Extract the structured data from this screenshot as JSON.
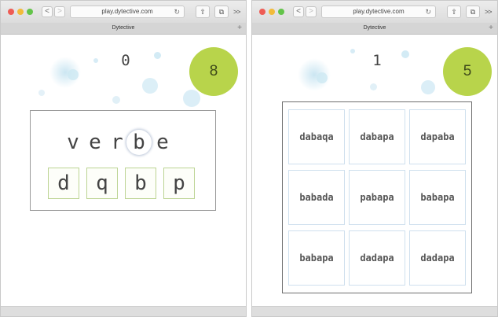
{
  "windows": [
    {
      "url": "play.dytective.com",
      "tab_title": "Dytective",
      "nav": {
        "back": "<",
        "forward": ">"
      },
      "icons": {
        "reload": "↻",
        "share": "⇧",
        "tabs": "⧉",
        "more": ">>",
        "new_tab": "+"
      },
      "score": "0",
      "timer": "8",
      "word_letters": [
        "v",
        "e",
        "r",
        "b",
        "e"
      ],
      "highlighted_letter_index": 3,
      "choices": [
        "d",
        "q",
        "b",
        "p"
      ]
    },
    {
      "url": "play.dytective.com",
      "tab_title": "Dytective",
      "nav": {
        "back": "<",
        "forward": ">"
      },
      "icons": {
        "reload": "↻",
        "share": "⇧",
        "tabs": "⧉",
        "more": ">>",
        "new_tab": "+"
      },
      "score": "1",
      "timer": "5",
      "grid_words": [
        [
          "dabaqa",
          "dabapa",
          "dapaba"
        ],
        [
          "babada",
          "pabapa",
          "babapa"
        ],
        [
          "babapa",
          "dadapa",
          "dadapa"
        ]
      ]
    }
  ],
  "colors": {
    "timer_green": "#b8d44b",
    "bubble_blue": "#cfe7f2",
    "choice_border": "#bcd493",
    "cell_border": "#cfe0ee"
  }
}
